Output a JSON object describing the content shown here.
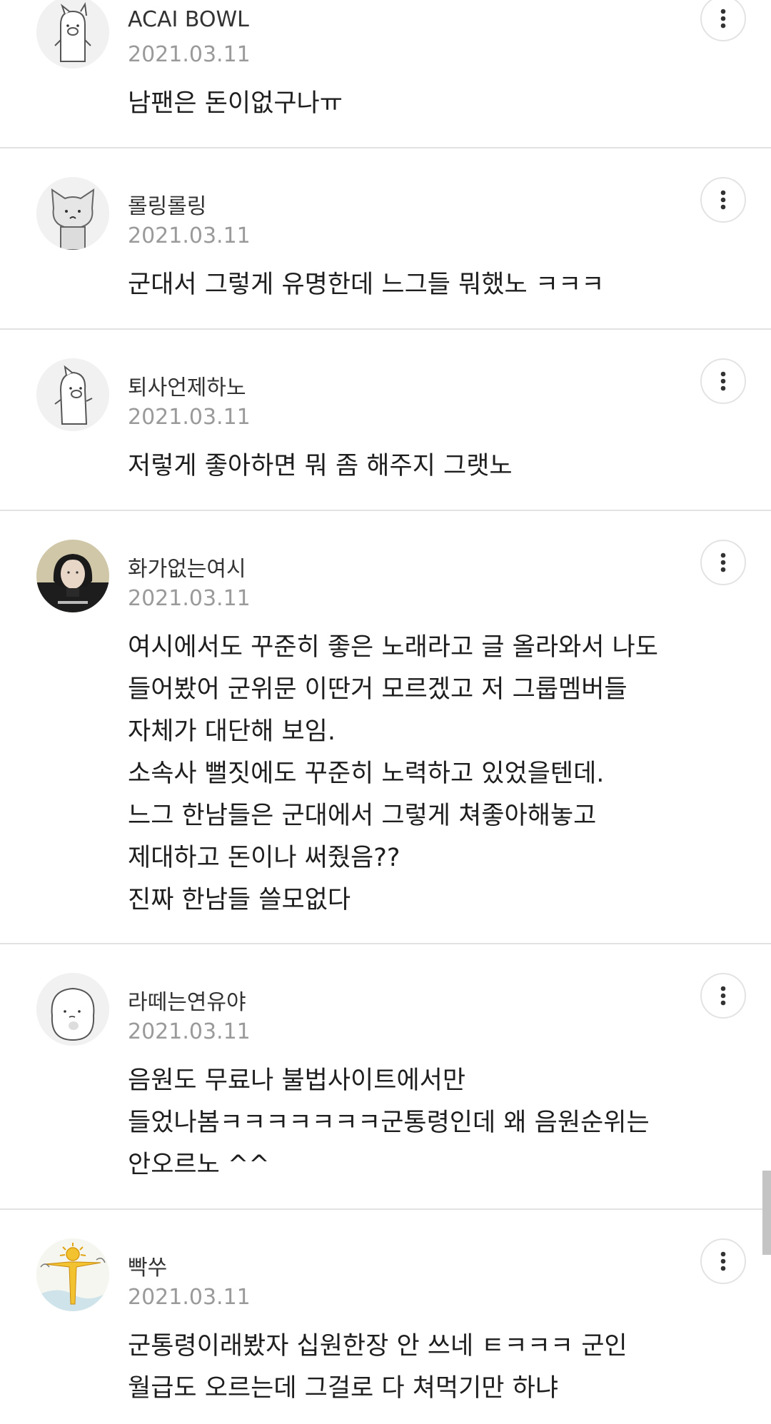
{
  "comments": [
    {
      "author": "ACAI BOWL",
      "date": "2021.03.11",
      "avatar": "pig-avatar-icon",
      "lines": [
        "남팬은 돈이없구나ㅠ"
      ]
    },
    {
      "author": "롤링롤링",
      "date": "2021.03.11",
      "avatar": "cat-avatar-icon",
      "lines": [
        "군대서 그렇게 유명한데 느그들 뭐했노 ㅋㅋㅋ"
      ]
    },
    {
      "author": "퇴사언제하노",
      "date": "2021.03.11",
      "avatar": "pig-avatar-icon",
      "lines": [
        "저렇게 좋아하면 뭐 좀 해주지 그랫노"
      ]
    },
    {
      "author": "화가없는여시",
      "date": "2021.03.11",
      "avatar": "woman-photo-avatar",
      "lines": [
        "여시에서도 꾸준히 좋은 노래라고 글 올라와서 나도",
        "들어봤어 군위문 이딴거 모르겠고 저 그룹멤버들",
        "자체가 대단해 보임.",
        "소속사 뻘짓에도 꾸준히 노력하고 있었을텐데.",
        "느그 한남들은 군대에서 그렇게 쳐좋아해놓고",
        "제대하고 돈이나 써줬음??",
        "진짜 한남들 쓸모없다"
      ]
    },
    {
      "author": "라떼는연유야",
      "date": "2021.03.11",
      "avatar": "blob-avatar-icon",
      "lines": [
        "음원도 무료나 불법사이트에서만",
        "들었나봄ㅋㅋㅋㅋㅋㅋㅋ군통령인데 왜 음원순위는",
        "안오르노 ^^"
      ]
    },
    {
      "author": "빡쑤",
      "date": "2021.03.11",
      "avatar": "sun-figure-avatar",
      "lines": [
        "군통령이래봤자 십원한장 안 쓰네 ㅌㅋㅋㅋ 군인",
        "월급도 오르는데 그걸로 다 쳐먹기만 하냐"
      ]
    }
  ],
  "more_icon": "more-vertical-icon",
  "colors": {
    "divider": "#e2e2e2",
    "date": "#9a9a9a",
    "text": "#1e1e1e"
  }
}
